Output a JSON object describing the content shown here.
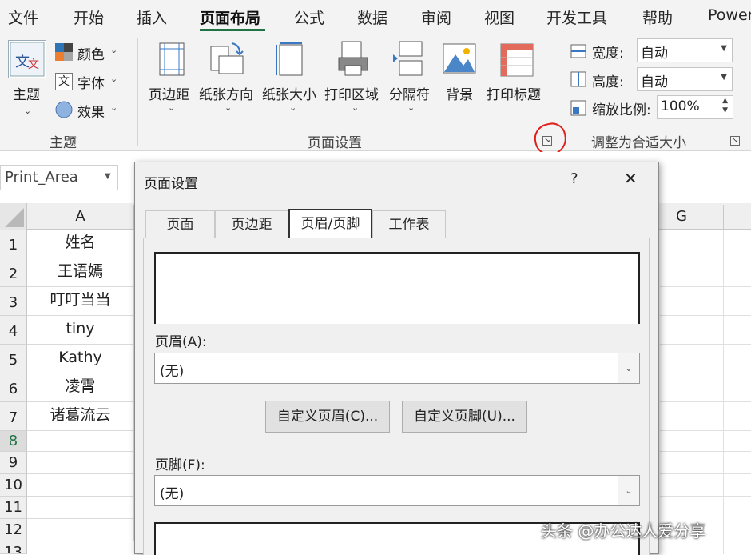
{
  "ribbon_tabs": [
    "文件",
    "开始",
    "插入",
    "页面布局",
    "公式",
    "数据",
    "审阅",
    "视图",
    "开发工具",
    "帮助",
    "Power"
  ],
  "theme_group": {
    "themes_label": "主题",
    "colors_label": "颜色",
    "fonts_label": "字体",
    "effects_label": "效果",
    "group_label": "主题"
  },
  "page_setup_group": {
    "buttons": [
      "页边距",
      "纸张方向",
      "纸张大小",
      "打印区域",
      "分隔符",
      "背景",
      "打印标题"
    ],
    "group_label": "页面设置"
  },
  "scale_group": {
    "width_label": "宽度:",
    "width_value": "自动",
    "height_label": "高度:",
    "height_value": "自动",
    "scale_label": "缩放比例:",
    "scale_value": "100%",
    "group_label": "调整为合适大小"
  },
  "name_box": "Print_Area",
  "columns": {
    "a": "A",
    "g": "G"
  },
  "rows": [
    "1",
    "2",
    "3",
    "4",
    "5",
    "6",
    "7",
    "8",
    "9",
    "10",
    "11",
    "12",
    "13"
  ],
  "cells": [
    "姓名",
    "王语嫣",
    "叮叮当当",
    "tiny",
    "Kathy",
    "凌霄",
    "诸葛流云"
  ],
  "dialog": {
    "title": "页面设置",
    "help": "?",
    "close": "✕",
    "tabs": [
      "页面",
      "页边距",
      "页眉/页脚",
      "工作表"
    ],
    "active_tab": "页眉/页脚",
    "header_label": "页眉(A):",
    "header_value": "(无)",
    "custom_header_button": "自定义页眉(C)...",
    "custom_footer_button": "自定义页脚(U)...",
    "footer_label": "页脚(F):",
    "footer_value": "(无)"
  },
  "watermark": "头条 @办公达人爱分享",
  "colors": {
    "accent": "#217346",
    "highlight": "#e0201b"
  }
}
